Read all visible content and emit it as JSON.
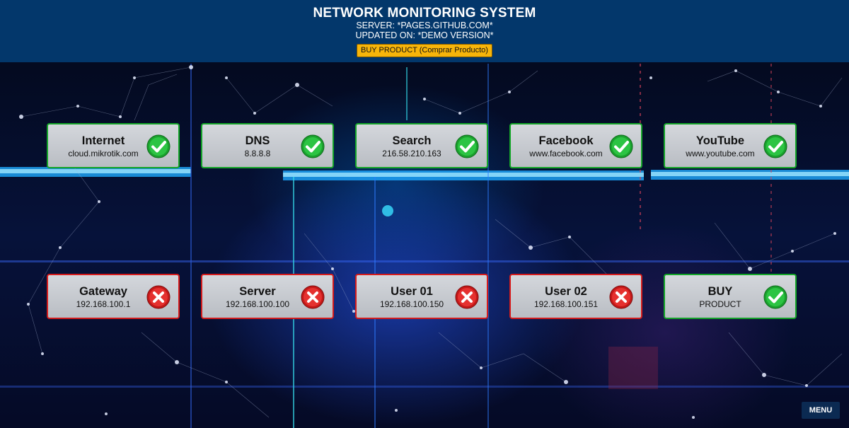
{
  "header": {
    "title": "NETWORK MONITORING SYSTEM",
    "server_line": "SERVER: *PAGES.GITHUB.COM*",
    "updated_line": "UPDATED ON: *DEMO VERSION*",
    "buy_button_label": "BUY PRODUCT (Comprar Producto)"
  },
  "colors": {
    "header_bg": "#03376b",
    "ok_border": "#14a528",
    "error_border": "#d61b1b",
    "buy_button": "#f7b50a"
  },
  "monitors": [
    {
      "name": "Internet",
      "address": "cloud.mikrotik.com",
      "status": "ok",
      "icon": "check-circle-icon"
    },
    {
      "name": "DNS",
      "address": "8.8.8.8",
      "status": "ok",
      "icon": "check-circle-icon"
    },
    {
      "name": "Search",
      "address": "216.58.210.163",
      "status": "ok",
      "icon": "check-circle-icon"
    },
    {
      "name": "Facebook",
      "address": "www.facebook.com",
      "status": "ok",
      "icon": "check-circle-icon"
    },
    {
      "name": "YouTube",
      "address": "www.youtube.com",
      "status": "ok",
      "icon": "check-circle-icon"
    },
    {
      "name": "Gateway",
      "address": "192.168.100.1",
      "status": "error",
      "icon": "x-circle-icon"
    },
    {
      "name": "Server",
      "address": "192.168.100.100",
      "status": "error",
      "icon": "x-circle-icon"
    },
    {
      "name": "User 01",
      "address": "192.168.100.150",
      "status": "error",
      "icon": "x-circle-icon"
    },
    {
      "name": "User 02",
      "address": "192.168.100.151",
      "status": "error",
      "icon": "x-circle-icon"
    },
    {
      "name": "BUY",
      "address": "PRODUCT",
      "status": "ok",
      "icon": "check-circle-icon"
    }
  ],
  "menu": {
    "label": "MENU"
  }
}
